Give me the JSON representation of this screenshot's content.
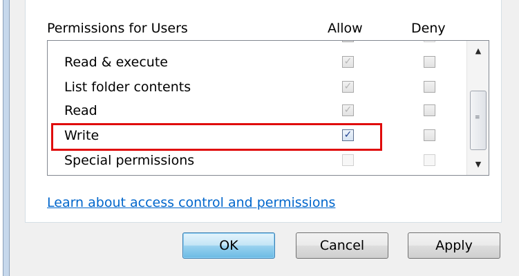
{
  "permissions": {
    "header": {
      "title": "Permissions for Users",
      "allow": "Allow",
      "deny": "Deny"
    },
    "rows": [
      {
        "label": "Read & execute",
        "allow": "✓",
        "deny": ""
      },
      {
        "label": "List folder contents",
        "allow": "✓",
        "deny": ""
      },
      {
        "label": "Read",
        "allow": "✓",
        "deny": ""
      },
      {
        "label": "Write",
        "allow": "✓",
        "deny": ""
      },
      {
        "label": "Special permissions",
        "allow": "",
        "deny": ""
      }
    ]
  },
  "scrollbar": {
    "up": "▲",
    "down": "▼",
    "grip": "≡"
  },
  "link": {
    "text": "Learn about access control and permissions"
  },
  "buttons": {
    "ok": "OK",
    "cancel": "Cancel",
    "apply": "Apply"
  },
  "colors": {
    "highlight": "#e00b0b",
    "link": "#0066cc",
    "default_button": "#6cbbe4"
  }
}
